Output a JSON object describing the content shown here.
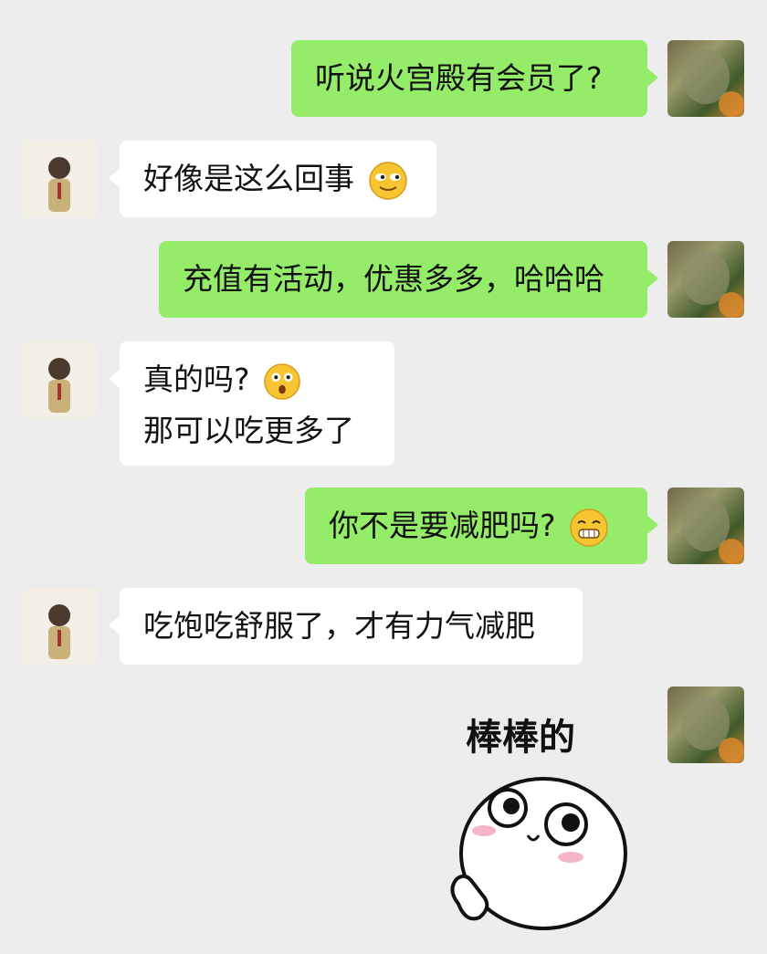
{
  "messages": [
    {
      "sender": "me",
      "text": "听说火宫殿有会员了?"
    },
    {
      "sender": "friend",
      "text": "好像是这么回事",
      "emoji": "smirk-emoji-icon"
    },
    {
      "sender": "me",
      "text": "充值有活动，优惠多多，哈哈哈"
    },
    {
      "sender": "friend",
      "lines": [
        "真的吗?",
        "那可以吃更多了"
      ],
      "emoji": "surprised-emoji-icon"
    },
    {
      "sender": "me",
      "text": "你不是要减肥吗?",
      "emoji": "grin-emoji-icon"
    },
    {
      "sender": "friend",
      "text": "吃饱吃舒服了，才有力气减肥"
    },
    {
      "sender": "me",
      "sticker": {
        "caption": "棒棒的",
        "icon": "thumbs-up-sticker-icon"
      }
    }
  ],
  "colors": {
    "me_bubble": "#95ec69",
    "friend_bubble": "#ffffff",
    "background": "#ededed"
  }
}
